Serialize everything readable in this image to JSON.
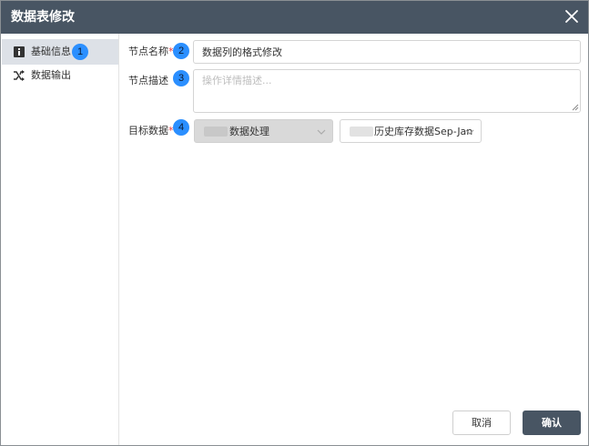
{
  "dialog": {
    "title": "数据表修改"
  },
  "sidebar": {
    "items": [
      {
        "label": "基础信息",
        "icon": "info-icon",
        "badge": "1"
      },
      {
        "label": "数据输出",
        "icon": "shuffle-icon"
      }
    ]
  },
  "form": {
    "node_name": {
      "label": "节点名称",
      "required": "*",
      "value": "数据列的格式修改",
      "badge": "2"
    },
    "node_desc": {
      "label": "节点描述",
      "placeholder": "操作详情描述...",
      "badge": "3"
    },
    "target": {
      "label": "目标数据",
      "required": "*",
      "badge": "4",
      "select1_value": "数据处理",
      "select2_value": "历史库存数据Sep-Jan"
    }
  },
  "footer": {
    "cancel_label": "取消",
    "ok_label": "确认"
  },
  "colors": {
    "header": "#485563",
    "badge": "#2b8fff",
    "active_item": "#dde1e7",
    "required": "#e4393c"
  }
}
